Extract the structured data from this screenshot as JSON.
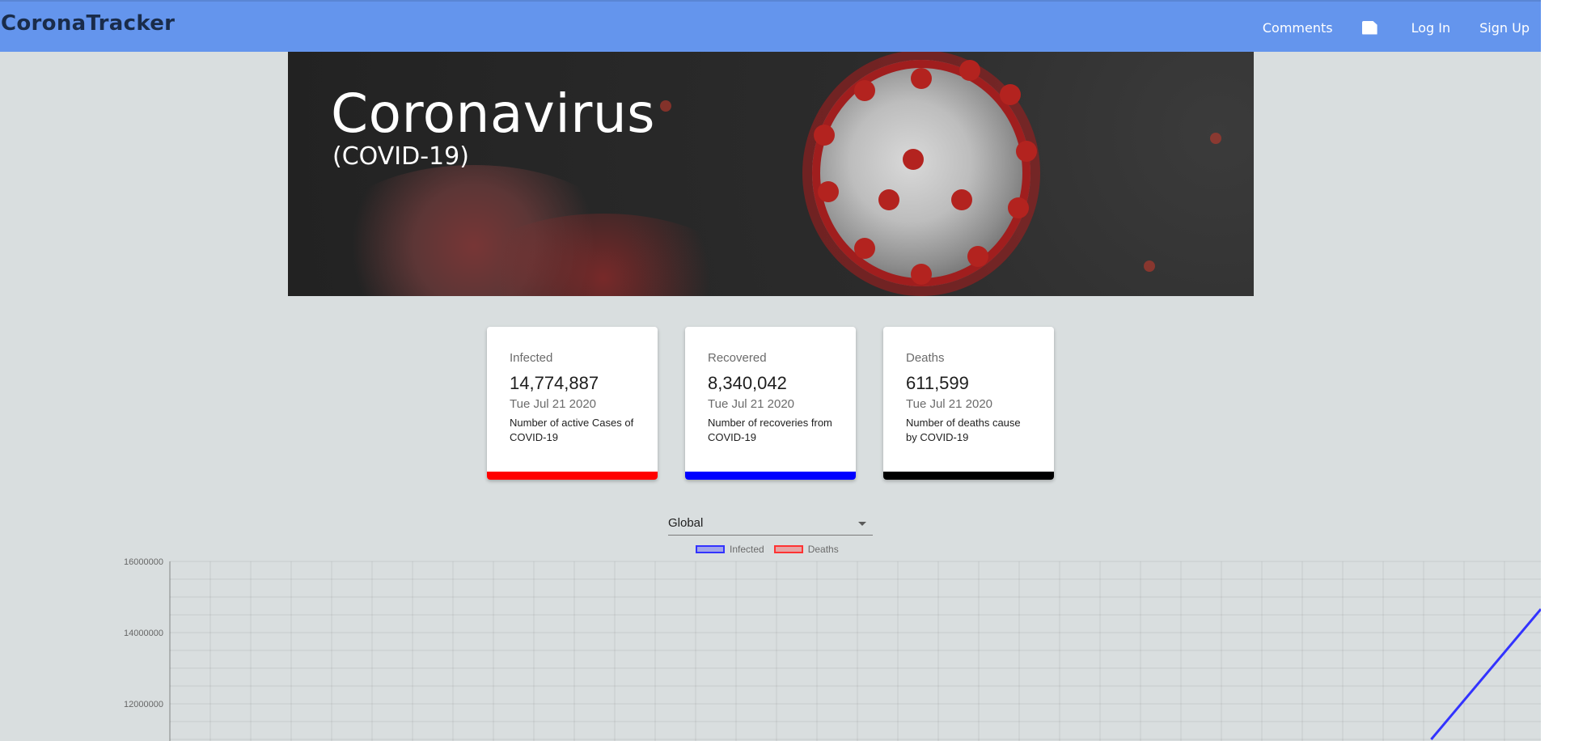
{
  "brand": "CoronaTracker",
  "nav": {
    "comments": "Comments",
    "bookmark_icon": "bookmark-icon",
    "login": "Log In",
    "signup": "Sign Up"
  },
  "hero": {
    "title": "Coronavirus",
    "subtitle": "(COVID-19)"
  },
  "cards": [
    {
      "label": "Infected",
      "value": "14,774,887",
      "date": "Tue Jul 21 2020",
      "description": "Number of active Cases of COVID-19",
      "color": "#ff0000"
    },
    {
      "label": "Recovered",
      "value": "8,340,042",
      "date": "Tue Jul 21 2020",
      "description": "Number of recoveries from COVID-19",
      "color": "#0000ff"
    },
    {
      "label": "Deaths",
      "value": "611,599",
      "date": "Tue Jul 21 2020",
      "description": "Number of deaths cause by COVID-19",
      "color": "#000000"
    }
  ],
  "country_select": {
    "value": "Global"
  },
  "chart_data": {
    "type": "line",
    "title": "",
    "xlabel": "",
    "ylabel": "",
    "legend_position": "top",
    "ylim": [
      11000000,
      16000000
    ],
    "y_ticks": [
      "16000000",
      "14000000",
      "12000000"
    ],
    "series": [
      {
        "name": "Infected",
        "color": "#3333ff",
        "x": [
          0.92,
          1.0
        ],
        "y": [
          11000000,
          14660000
        ]
      },
      {
        "name": "Deaths",
        "color": "#ff3333",
        "x": [],
        "y": []
      }
    ],
    "grid": true
  }
}
